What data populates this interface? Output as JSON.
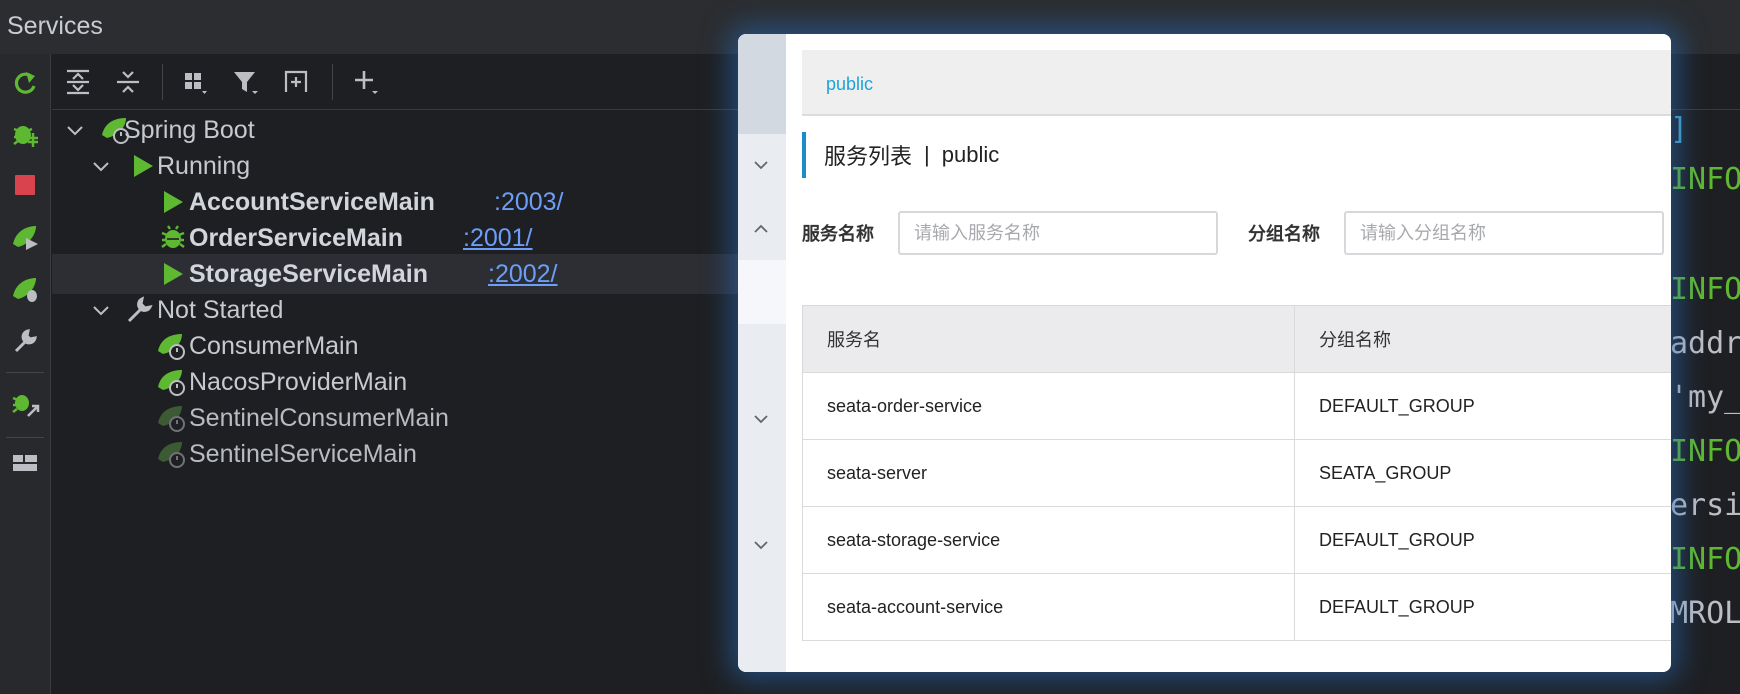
{
  "window": {
    "title": "Services"
  },
  "toolbar": {
    "buttons": [
      "expand-all-icon",
      "collapse-all-icon",
      "group-by-icon",
      "filter-icon",
      "new-service-icon",
      "add-icon"
    ]
  },
  "tree": {
    "spring_boot": "Spring Boot",
    "running": "Running",
    "services": [
      {
        "name": "AccountServiceMain",
        "port": ":2003/"
      },
      {
        "name": "OrderServiceMain",
        "port": ":2001/"
      },
      {
        "name": "StorageServiceMain",
        "port": ":2002/"
      }
    ],
    "not_started": "Not Started",
    "idle": [
      "ConsumerMain",
      "NacosProviderMain",
      "SentinelConsumerMain",
      "SentinelServiceMain"
    ]
  },
  "console": {
    "lines": [
      "]",
      "INFO",
      "INFO",
      "addr",
      "'my_",
      "INFO",
      "ersi",
      "INFO",
      "MROL"
    ]
  },
  "nacos": {
    "namespace": "public",
    "section_title": "服务列表",
    "section_sep": "|",
    "section_namespace": "public",
    "service_name_label": "服务名称",
    "service_name_placeholder": "请输入服务名称",
    "group_name_label": "分组名称",
    "group_name_placeholder": "请输入分组名称",
    "columns": [
      "服务名",
      "分组名称"
    ],
    "rows": [
      [
        "seata-order-service",
        "DEFAULT_GROUP"
      ],
      [
        "seata-server",
        "SEATA_GROUP"
      ],
      [
        "seata-storage-service",
        "DEFAULT_GROUP"
      ],
      [
        "seata-account-service",
        "DEFAULT_GROUP"
      ]
    ]
  },
  "colors": {
    "accent_green": "#5fb832",
    "link_blue": "#6c9ef8",
    "nacos_blue": "#1fa3d8",
    "stop_red": "#d9434e"
  }
}
